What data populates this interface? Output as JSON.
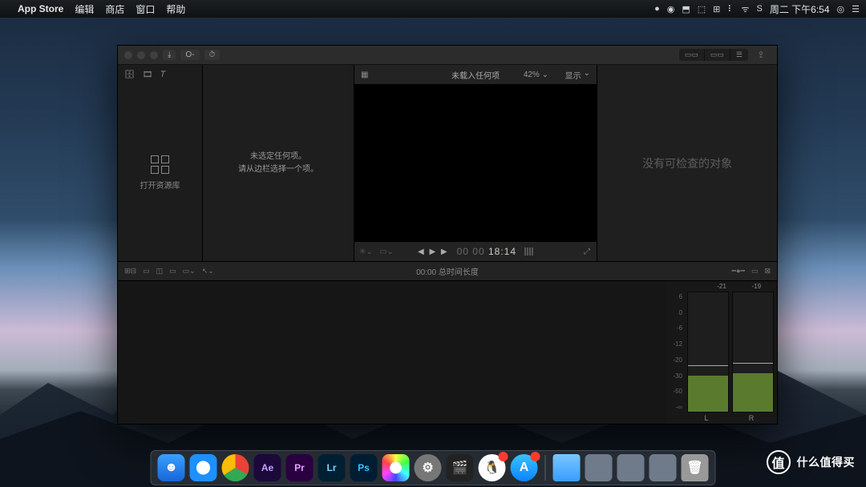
{
  "menubar": {
    "app_name": "App Store",
    "items": [
      "编辑",
      "商店",
      "窗口",
      "帮助"
    ],
    "clock": "周二 下午6:54"
  },
  "window": {
    "toolbar": {
      "import_label": "⤓",
      "keyword_label": "O-",
      "clock_icon": "⏱"
    },
    "seg": [
      "▭▭",
      "▭▭",
      "☰"
    ],
    "share_label": "⇪",
    "library": {
      "label": "打开资源库"
    },
    "browser": {
      "line1": "未选定任何项。",
      "line2": "请从边栏选择一个项。"
    },
    "viewer": {
      "title": "未载入任何项",
      "zoom": "42%",
      "zoom_arrow": "⌄",
      "display": "显示",
      "display_arrow": "⌄",
      "timecode_prefix": "00 00",
      "timecode": "18:14"
    },
    "inspector": {
      "empty": "没有可检查的对象"
    },
    "timeline": {
      "ruler": "00:00 总时间长度"
    },
    "meters": {
      "peak_l": "-21",
      "peak_r": "-19",
      "scale": [
        "6",
        "0",
        "-6",
        "-12",
        "-20",
        "-30",
        "-50",
        "-∞"
      ],
      "fill_l_pct": 30,
      "fill_r_pct": 32,
      "peak_l_pct": 38,
      "peak_r_pct": 40,
      "label_l": "L",
      "label_r": "R"
    }
  },
  "watermark": {
    "mark": "值",
    "text": "什么值得买"
  },
  "dock": {
    "finder": "☻",
    "safari": "",
    "chrome": "",
    "ae": "Ae",
    "pr": "Pr",
    "lr": "Lr",
    "ps": "Ps",
    "photos": "",
    "settings": "⚙",
    "fcpx": "🎬",
    "qq": "🐧",
    "store": "A",
    "folder": "",
    "g1": "",
    "g2": "",
    "g3": "",
    "trash": "🗑"
  }
}
